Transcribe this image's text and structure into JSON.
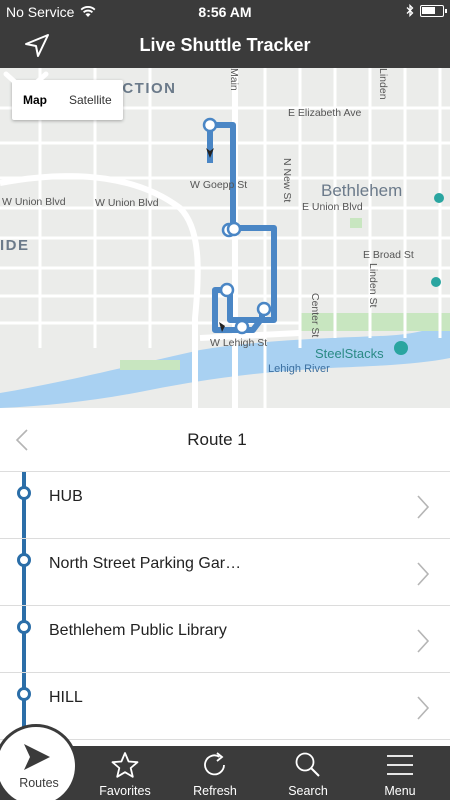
{
  "status_bar": {
    "carrier": "No Service",
    "time": "8:56 AM"
  },
  "header": {
    "title": "Live Shuttle Tracker"
  },
  "map": {
    "type_toggle": {
      "map_label": "Map",
      "satellite_label": "Satellite",
      "selected": "Map"
    },
    "labels": {
      "junction": "NCTION",
      "bethlehem": "Bethlehem",
      "e_elizabeth": "E Elizabeth Ave",
      "w_union_left": "W Union Blvd",
      "w_union_mid": "W Union Blvd",
      "e_union": "E Union Blvd",
      "w_goepp": "W Goepp St",
      "e_broad": "E Broad St",
      "n_new": "N New St",
      "linden": "Linden St",
      "center": "Center St",
      "w_lehigh": "W Lehigh St",
      "lehigh_river": "Lehigh River",
      "steelstacks": "SteelStacks",
      "ide": "IDE",
      "main": "Main",
      "linden_top": "Linden"
    },
    "route_color": "#4a86c5"
  },
  "route": {
    "title": "Route 1"
  },
  "stops": [
    {
      "name": "HUB"
    },
    {
      "name": "North Street Parking Gar…"
    },
    {
      "name": "Bethlehem Public Library"
    },
    {
      "name": "HILL"
    }
  ],
  "tabs": [
    {
      "label": "Routes",
      "icon": "routes-icon",
      "active": true
    },
    {
      "label": "Favorites",
      "icon": "star-icon"
    },
    {
      "label": "Refresh",
      "icon": "refresh-icon"
    },
    {
      "label": "Search",
      "icon": "search-icon"
    },
    {
      "label": "Menu",
      "icon": "menu-icon"
    }
  ]
}
